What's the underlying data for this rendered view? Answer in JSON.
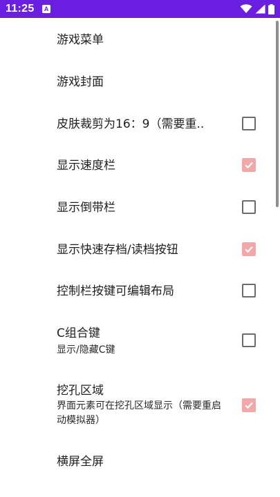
{
  "status_bar": {
    "time": "11:25",
    "notification_icon": "a-badge-icon",
    "icons": [
      "wifi-icon",
      "signal-icon",
      "battery-icon"
    ],
    "background_color": "#6a1fe0"
  },
  "settings": {
    "checked_color": "#f2a8a8",
    "items": [
      {
        "title": "游戏菜单"
      },
      {
        "title": "游戏封面"
      },
      {
        "title": "皮肤裁剪为16：9（需要重..",
        "checked": false
      },
      {
        "title": "显示速度栏",
        "checked": true
      },
      {
        "title": "显示倒带栏",
        "checked": false
      },
      {
        "title": "显示快速存档/读档按钮",
        "checked": true
      },
      {
        "title": "控制栏按键可编辑布局",
        "checked": false
      },
      {
        "title": "C组合键",
        "summary": "显示/隐藏C键",
        "checked": false
      },
      {
        "title": "挖孔区域",
        "summary": "界面元素可在挖孔区域显示（需要重启动模拟器）",
        "checked": true
      },
      {
        "title": "横屏全屏"
      }
    ]
  }
}
